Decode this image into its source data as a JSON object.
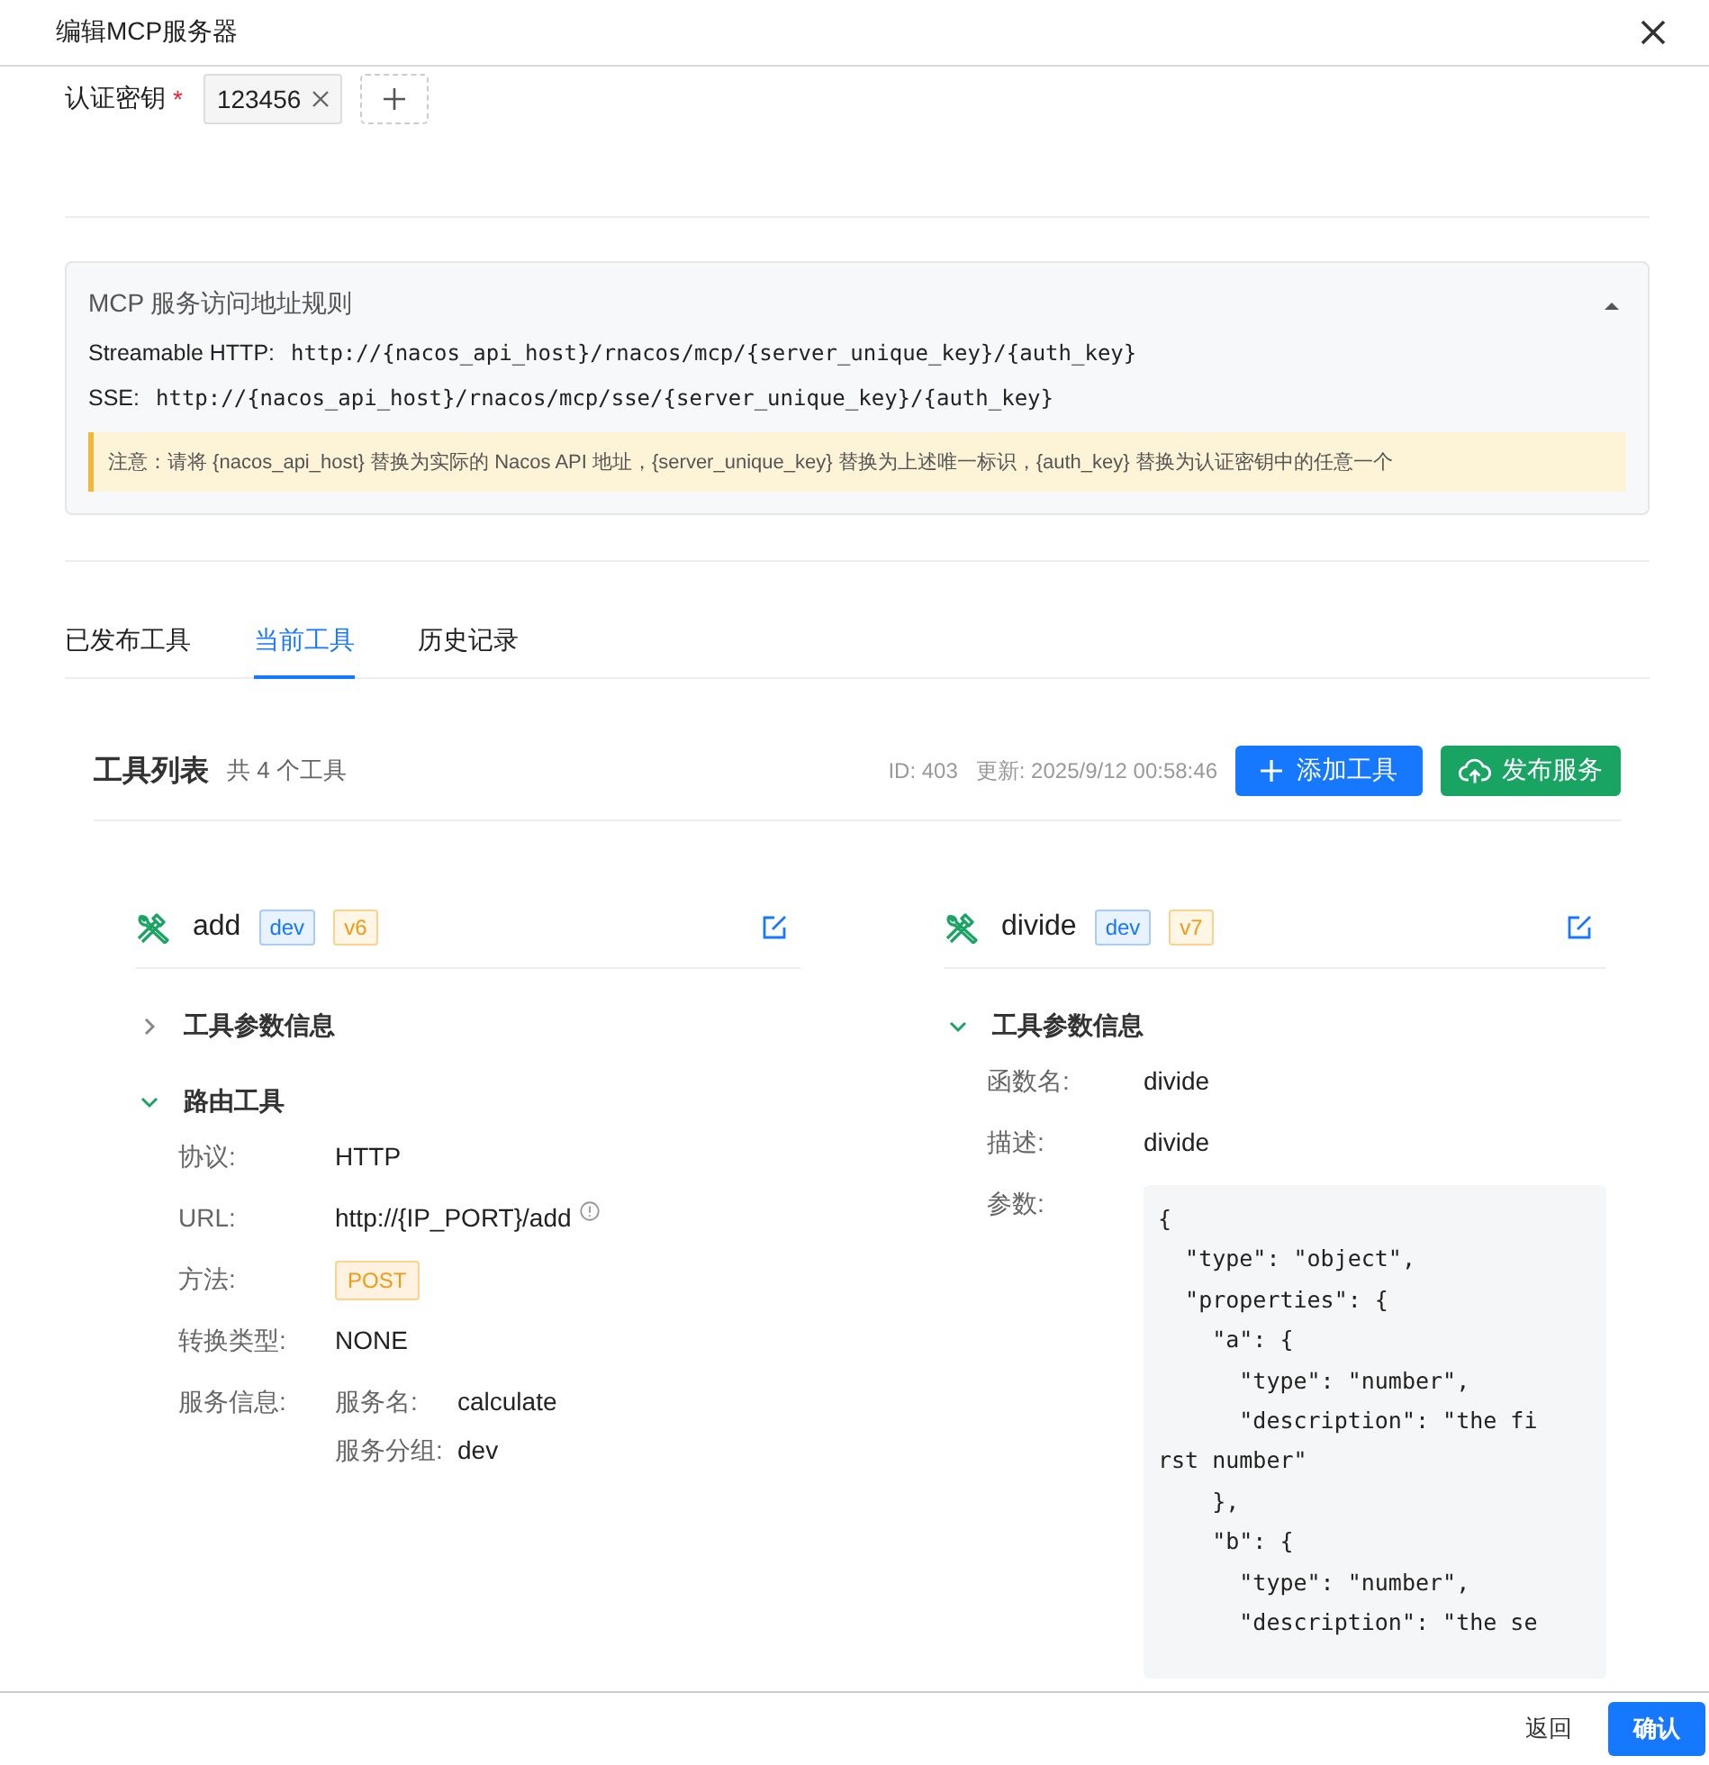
{
  "dialog": {
    "title": "编辑MCP服务器"
  },
  "auth_keys": {
    "label": "认证密钥",
    "required_mark": "*",
    "tags": [
      "123456"
    ]
  },
  "address_rules": {
    "title": "MCP 服务访问地址规则",
    "expanded": true,
    "rules": [
      {
        "label": "Streamable HTTP:",
        "url": "http://{nacos_api_host}/rnacos/mcp/{server_unique_key}/{auth_key}"
      },
      {
        "label": "SSE:",
        "url": "http://{nacos_api_host}/rnacos/mcp/sse/{server_unique_key}/{auth_key}"
      }
    ],
    "notice": "注意：请将 {nacos_api_host} 替换为实际的 Nacos API 地址，{server_unique_key} 替换为上述唯一标识，{auth_key} 替换为认证密钥中的任意一个"
  },
  "tabs": [
    {
      "label": "已发布工具",
      "selected": false
    },
    {
      "label": "当前工具",
      "selected": true
    },
    {
      "label": "历史记录",
      "selected": false
    }
  ],
  "tool_list": {
    "title": "工具列表",
    "count": "共 4 个工具",
    "id": "ID: 403",
    "updated": "更新: 2025/9/12 00:58:46",
    "buttons": [
      {
        "kind": "add",
        "label": "添加工具"
      },
      {
        "kind": "publish",
        "label": "发布服务"
      }
    ]
  },
  "tools": [
    {
      "name": "add",
      "tags": [
        {
          "kind": "env",
          "text": "dev"
        },
        {
          "kind": "version",
          "text": "v6"
        }
      ],
      "sections": [
        {
          "title": "工具参数信息",
          "expanded": false
        },
        {
          "title": "路由工具",
          "expanded": true,
          "fields": [
            {
              "kind": "text",
              "label": "协议:",
              "value": "HTTP"
            },
            {
              "kind": "info",
              "label": "URL:",
              "value": "http://{IP_PORT}/add"
            },
            {
              "kind": "method",
              "label": "方法:",
              "value": "POST"
            },
            {
              "kind": "text",
              "label": "转换类型:",
              "value": "NONE"
            },
            {
              "kind": "pairs",
              "label": "服务信息:",
              "pairs": [
                {
                  "label": "服务名:",
                  "value": "calculate"
                },
                {
                  "label": "服务分组:",
                  "value": "dev"
                }
              ]
            }
          ]
        }
      ]
    },
    {
      "name": "divide",
      "tags": [
        {
          "kind": "env",
          "text": "dev"
        },
        {
          "kind": "version",
          "text": "v7"
        }
      ],
      "sections": [
        {
          "title": "工具参数信息",
          "expanded": true,
          "fields": [
            {
              "kind": "text",
              "label": "函数名:",
              "value": "divide"
            },
            {
              "kind": "text",
              "label": "描述:",
              "value": "divide"
            },
            {
              "kind": "code",
              "label": "参数:",
              "value": "{\n  \"type\": \"object\",\n  \"properties\": {\n    \"a\": {\n      \"type\": \"number\",\n      \"description\": \"the fi\nrst number\"\n    },\n    \"b\": {\n      \"type\": \"number\",\n      \"description\": \"the se"
            }
          ]
        }
      ]
    }
  ],
  "footer": {
    "buttons": [
      {
        "kind": "plain",
        "label": "返回"
      },
      {
        "kind": "primary",
        "label": "确认"
      }
    ]
  }
}
